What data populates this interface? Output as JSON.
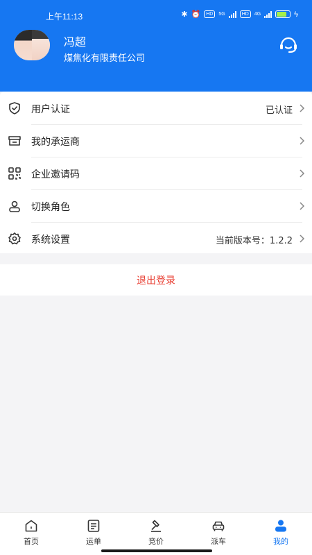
{
  "status_bar": {
    "time": "上午11:13",
    "network_labels": [
      "5G",
      "4G"
    ],
    "battery_level": "79"
  },
  "profile": {
    "name": "冯超",
    "company": "煤焦化有限责任公司"
  },
  "menu": {
    "items": [
      {
        "label": "用户认证",
        "value": "已认证",
        "icon": "shield-check-icon"
      },
      {
        "label": "我的承运商",
        "value": "",
        "icon": "store-icon"
      },
      {
        "label": "企业邀请码",
        "value": "",
        "icon": "qr-code-icon"
      },
      {
        "label": "切换角色",
        "value": "",
        "icon": "user-icon"
      },
      {
        "label": "系统设置",
        "value": "当前版本号：1.2.2",
        "icon": "gear-icon"
      }
    ]
  },
  "logout": {
    "label": "退出登录"
  },
  "tabbar": {
    "items": [
      {
        "label": "首页",
        "icon": "home-icon"
      },
      {
        "label": "运单",
        "icon": "waybill-icon"
      },
      {
        "label": "竞价",
        "icon": "gavel-icon"
      },
      {
        "label": "派车",
        "icon": "car-icon"
      },
      {
        "label": "我的",
        "icon": "profile-icon"
      }
    ],
    "active_index": 4
  },
  "colors": {
    "brand_blue": "#1677f2",
    "logout_red": "#e83b2f",
    "battery_green": "#a6f04a"
  }
}
